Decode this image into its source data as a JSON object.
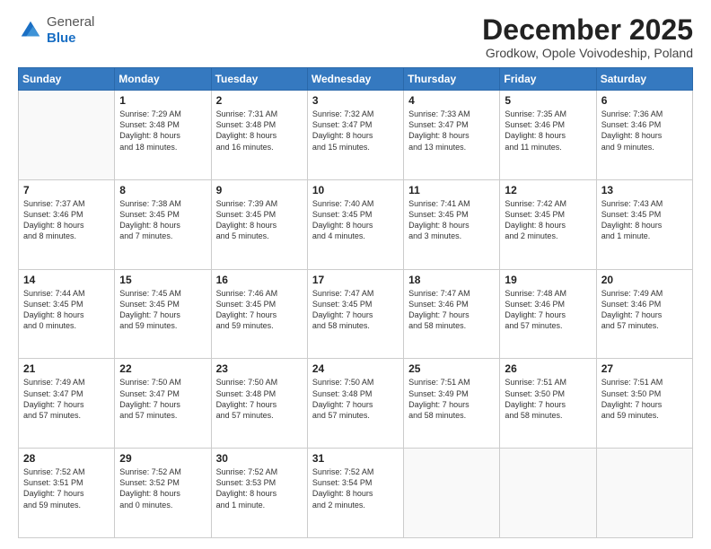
{
  "header": {
    "logo_general": "General",
    "logo_blue": "Blue",
    "month_title": "December 2025",
    "location": "Grodkow, Opole Voivodeship, Poland"
  },
  "days_of_week": [
    "Sunday",
    "Monday",
    "Tuesday",
    "Wednesday",
    "Thursday",
    "Friday",
    "Saturday"
  ],
  "weeks": [
    [
      {
        "day": "",
        "info": ""
      },
      {
        "day": "1",
        "info": "Sunrise: 7:29 AM\nSunset: 3:48 PM\nDaylight: 8 hours\nand 18 minutes."
      },
      {
        "day": "2",
        "info": "Sunrise: 7:31 AM\nSunset: 3:48 PM\nDaylight: 8 hours\nand 16 minutes."
      },
      {
        "day": "3",
        "info": "Sunrise: 7:32 AM\nSunset: 3:47 PM\nDaylight: 8 hours\nand 15 minutes."
      },
      {
        "day": "4",
        "info": "Sunrise: 7:33 AM\nSunset: 3:47 PM\nDaylight: 8 hours\nand 13 minutes."
      },
      {
        "day": "5",
        "info": "Sunrise: 7:35 AM\nSunset: 3:46 PM\nDaylight: 8 hours\nand 11 minutes."
      },
      {
        "day": "6",
        "info": "Sunrise: 7:36 AM\nSunset: 3:46 PM\nDaylight: 8 hours\nand 9 minutes."
      }
    ],
    [
      {
        "day": "7",
        "info": "Sunrise: 7:37 AM\nSunset: 3:46 PM\nDaylight: 8 hours\nand 8 minutes."
      },
      {
        "day": "8",
        "info": "Sunrise: 7:38 AM\nSunset: 3:45 PM\nDaylight: 8 hours\nand 7 minutes."
      },
      {
        "day": "9",
        "info": "Sunrise: 7:39 AM\nSunset: 3:45 PM\nDaylight: 8 hours\nand 5 minutes."
      },
      {
        "day": "10",
        "info": "Sunrise: 7:40 AM\nSunset: 3:45 PM\nDaylight: 8 hours\nand 4 minutes."
      },
      {
        "day": "11",
        "info": "Sunrise: 7:41 AM\nSunset: 3:45 PM\nDaylight: 8 hours\nand 3 minutes."
      },
      {
        "day": "12",
        "info": "Sunrise: 7:42 AM\nSunset: 3:45 PM\nDaylight: 8 hours\nand 2 minutes."
      },
      {
        "day": "13",
        "info": "Sunrise: 7:43 AM\nSunset: 3:45 PM\nDaylight: 8 hours\nand 1 minute."
      }
    ],
    [
      {
        "day": "14",
        "info": "Sunrise: 7:44 AM\nSunset: 3:45 PM\nDaylight: 8 hours\nand 0 minutes."
      },
      {
        "day": "15",
        "info": "Sunrise: 7:45 AM\nSunset: 3:45 PM\nDaylight: 7 hours\nand 59 minutes."
      },
      {
        "day": "16",
        "info": "Sunrise: 7:46 AM\nSunset: 3:45 PM\nDaylight: 7 hours\nand 59 minutes."
      },
      {
        "day": "17",
        "info": "Sunrise: 7:47 AM\nSunset: 3:45 PM\nDaylight: 7 hours\nand 58 minutes."
      },
      {
        "day": "18",
        "info": "Sunrise: 7:47 AM\nSunset: 3:46 PM\nDaylight: 7 hours\nand 58 minutes."
      },
      {
        "day": "19",
        "info": "Sunrise: 7:48 AM\nSunset: 3:46 PM\nDaylight: 7 hours\nand 57 minutes."
      },
      {
        "day": "20",
        "info": "Sunrise: 7:49 AM\nSunset: 3:46 PM\nDaylight: 7 hours\nand 57 minutes."
      }
    ],
    [
      {
        "day": "21",
        "info": "Sunrise: 7:49 AM\nSunset: 3:47 PM\nDaylight: 7 hours\nand 57 minutes."
      },
      {
        "day": "22",
        "info": "Sunrise: 7:50 AM\nSunset: 3:47 PM\nDaylight: 7 hours\nand 57 minutes."
      },
      {
        "day": "23",
        "info": "Sunrise: 7:50 AM\nSunset: 3:48 PM\nDaylight: 7 hours\nand 57 minutes."
      },
      {
        "day": "24",
        "info": "Sunrise: 7:50 AM\nSunset: 3:48 PM\nDaylight: 7 hours\nand 57 minutes."
      },
      {
        "day": "25",
        "info": "Sunrise: 7:51 AM\nSunset: 3:49 PM\nDaylight: 7 hours\nand 58 minutes."
      },
      {
        "day": "26",
        "info": "Sunrise: 7:51 AM\nSunset: 3:50 PM\nDaylight: 7 hours\nand 58 minutes."
      },
      {
        "day": "27",
        "info": "Sunrise: 7:51 AM\nSunset: 3:50 PM\nDaylight: 7 hours\nand 59 minutes."
      }
    ],
    [
      {
        "day": "28",
        "info": "Sunrise: 7:52 AM\nSunset: 3:51 PM\nDaylight: 7 hours\nand 59 minutes."
      },
      {
        "day": "29",
        "info": "Sunrise: 7:52 AM\nSunset: 3:52 PM\nDaylight: 8 hours\nand 0 minutes."
      },
      {
        "day": "30",
        "info": "Sunrise: 7:52 AM\nSunset: 3:53 PM\nDaylight: 8 hours\nand 1 minute."
      },
      {
        "day": "31",
        "info": "Sunrise: 7:52 AM\nSunset: 3:54 PM\nDaylight: 8 hours\nand 2 minutes."
      },
      {
        "day": "",
        "info": ""
      },
      {
        "day": "",
        "info": ""
      },
      {
        "day": "",
        "info": ""
      }
    ]
  ]
}
